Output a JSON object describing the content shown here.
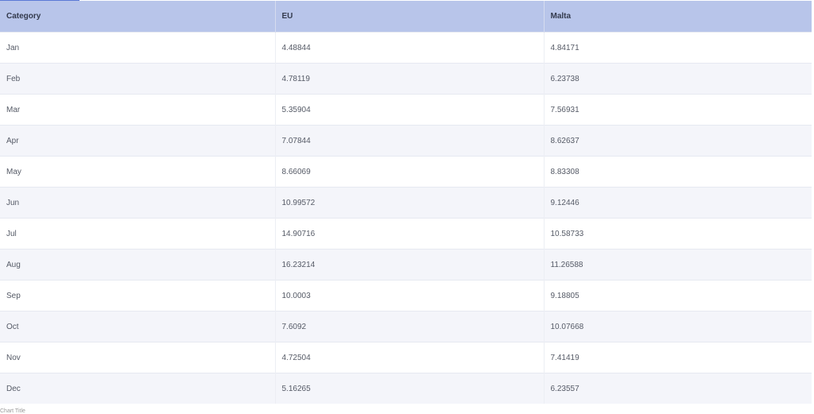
{
  "chart_data": {
    "type": "table",
    "columns": [
      "Category",
      "EU",
      "Malta"
    ],
    "categories": [
      "Jan",
      "Feb",
      "Mar",
      "Apr",
      "May",
      "Jun",
      "Jul",
      "Aug",
      "Sep",
      "Oct",
      "Nov",
      "Dec"
    ],
    "series": [
      {
        "name": "EU",
        "values": [
          "4.48844",
          "4.78119",
          "5.35904",
          "7.07844",
          "8.66069",
          "10.99572",
          "14.90716",
          "16.23214",
          "10.0003",
          "7.6092",
          "4.72504",
          "5.16265"
        ]
      },
      {
        "name": "Malta",
        "values": [
          "4.84171",
          "6.23738",
          "7.56931",
          "8.62637",
          "8.83308",
          "9.12446",
          "10.58733",
          "11.26588",
          "9.18805",
          "10.07668",
          "7.41419",
          "6.23557"
        ]
      }
    ],
    "footer": "Chart Title"
  },
  "colors": {
    "header_bg": "#b8c5ea",
    "accent": "#5b79d6"
  }
}
